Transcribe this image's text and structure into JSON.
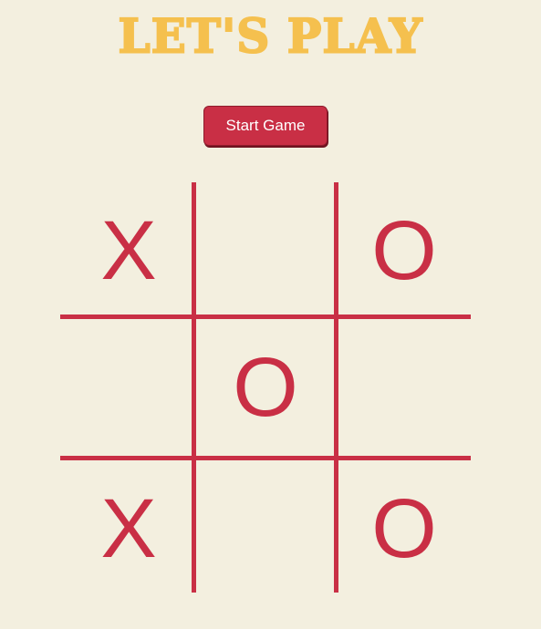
{
  "title": "LET'S PLAY",
  "start_button_label": "Start Game",
  "board": {
    "cells": [
      "X",
      "",
      "O",
      "",
      "O",
      "",
      "X",
      "",
      "O"
    ]
  },
  "colors": {
    "background": "#f3efdf",
    "title": "#f5c04e",
    "accent": "#c92f45"
  }
}
